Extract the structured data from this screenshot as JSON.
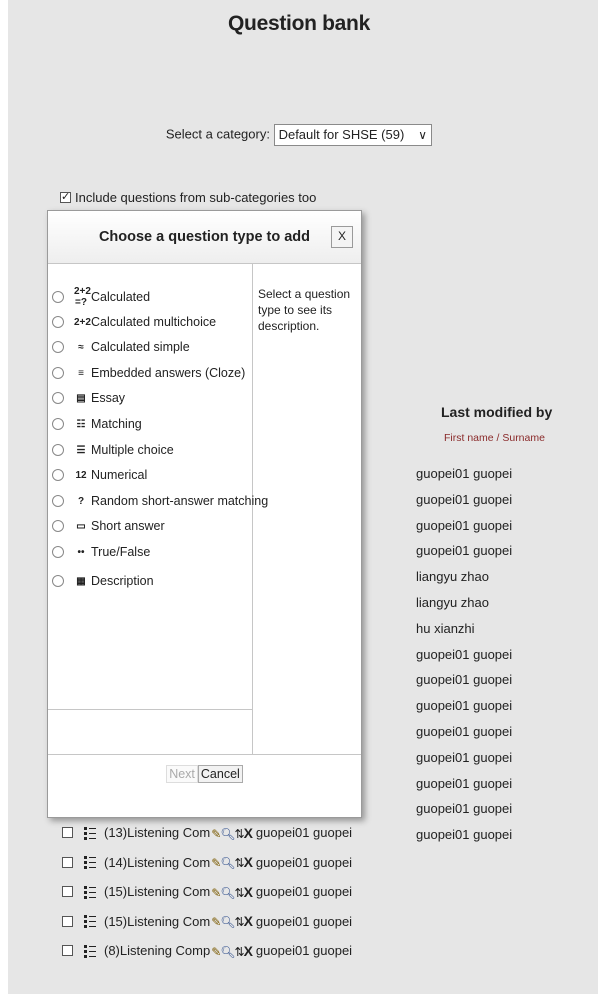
{
  "page": {
    "title": "Question bank"
  },
  "category": {
    "label": "Select a category:",
    "selected": "Default for SHSE (59)"
  },
  "include_subcategories": {
    "label": "Include questions from sub-categories too",
    "checked": true
  },
  "table": {
    "last_modified_header": "Last modified by",
    "sort_links": "First name / Surname",
    "last_modified_values": [
      "guopei01 guopei",
      "guopei01 guopei",
      "guopei01 guopei",
      "guopei01 guopei",
      "liangyu zhao",
      "liangyu zhao",
      "hu xianzhi",
      "guopei01 guopei",
      "guopei01 guopei",
      "guopei01 guopei",
      "guopei01 guopei",
      "guopei01 guopei",
      "guopei01 guopei",
      "guopei01 guopei",
      "guopei01 guopei"
    ],
    "visible_rows": [
      {
        "name": "(13)Listening Com",
        "created_by": "guopei01 guopei",
        "icon": "multichoice-icon"
      },
      {
        "name": "(14)Listening Com",
        "created_by": "guopei01 guopei",
        "icon": "multichoice-icon"
      },
      {
        "name": "(15)Listening Com",
        "created_by": "guopei01 guopei",
        "icon": "multichoice-icon"
      },
      {
        "name": "(15)Listening Com",
        "created_by": "guopei01 guopei",
        "icon": "multichoice-icon"
      },
      {
        "name": "(8)Listening Comp",
        "created_by": "guopei01 guopei",
        "icon": "multichoice-icon"
      }
    ]
  },
  "dialog": {
    "title": "Choose a question type to add",
    "close_label": "X",
    "description": "Select a question type to see its description.",
    "options": [
      {
        "label": "Calculated",
        "icon": "2+2\n=?"
      },
      {
        "label": "Calculated multichoice",
        "icon": "2+2"
      },
      {
        "label": "Calculated simple",
        "icon": "≈"
      },
      {
        "label": "Embedded answers (Cloze)",
        "icon": "≡"
      },
      {
        "label": "Essay",
        "icon": "▤"
      },
      {
        "label": "Matching",
        "icon": "☷"
      },
      {
        "label": "Multiple choice",
        "icon": "☰"
      },
      {
        "label": "Numerical",
        "icon": "12"
      },
      {
        "label": "Random short-answer matching",
        "icon": "?"
      },
      {
        "label": "Short answer",
        "icon": "▭"
      },
      {
        "label": "True/False",
        "icon": "••"
      },
      {
        "label": "Description",
        "icon": "▦"
      }
    ],
    "next_label": "Next",
    "cancel_label": "Cancel"
  }
}
